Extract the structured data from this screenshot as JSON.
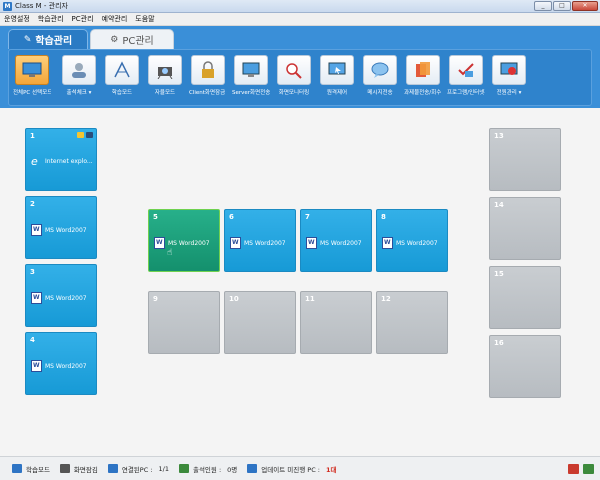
{
  "window": {
    "title": "Class M - 관리자",
    "minimize": "_",
    "maximize": "□",
    "close": "✕",
    "app_icon": "M"
  },
  "menu": [
    "운영설정",
    "학습관리",
    "PC관리",
    "예약관리",
    "도움말"
  ],
  "tabs": [
    {
      "label": "학습관리",
      "icon": "pencil-icon"
    },
    {
      "label": "PC관리",
      "icon": "gear-icon"
    }
  ],
  "toolbar": [
    {
      "label": "전체PC 선택모드",
      "icon": "monitor-icon",
      "selected": true
    },
    {
      "label": "출석체크 ▾",
      "icon": "attendance-icon"
    },
    {
      "label": "학습모드",
      "icon": "drawing-icon"
    },
    {
      "label": "자율모드",
      "icon": "camera-icon"
    },
    {
      "label": "Client화면잠금 ▾",
      "icon": "lock-icon"
    },
    {
      "label": "Server화면전송",
      "icon": "screen-send-icon"
    },
    {
      "label": "화면모니터링",
      "icon": "magnifier-icon"
    },
    {
      "label": "원격제어",
      "icon": "remote-control-icon"
    },
    {
      "label": "메시지전송",
      "icon": "message-icon"
    },
    {
      "label": "과제물전송/회수 ▾",
      "icon": "assignment-icon"
    },
    {
      "label": "프로그램/인터넷관리",
      "icon": "program-control-icon"
    },
    {
      "label": "전원관리 ▾",
      "icon": "power-icon"
    }
  ],
  "seats": [
    {
      "num": "1",
      "app": "Internet explo...",
      "state": "blue",
      "icon": "ie-icon"
    },
    {
      "num": "2",
      "app": "MS Word2007",
      "state": "blue",
      "icon": "word-icon"
    },
    {
      "num": "3",
      "app": "MS Word2007",
      "state": "blue",
      "icon": "word-icon"
    },
    {
      "num": "4",
      "app": "MS Word2007",
      "state": "blue",
      "icon": "word-icon"
    },
    {
      "num": "5",
      "app": "MS Word2007",
      "state": "green",
      "icon": "word-icon"
    },
    {
      "num": "6",
      "app": "MS Word2007",
      "state": "blue",
      "icon": "word-icon"
    },
    {
      "num": "7",
      "app": "MS Word2007",
      "state": "blue",
      "icon": "word-icon"
    },
    {
      "num": "8",
      "app": "MS Word2007",
      "state": "blue",
      "icon": "word-icon"
    },
    {
      "num": "9",
      "app": "",
      "state": "gray"
    },
    {
      "num": "10",
      "app": "",
      "state": "gray"
    },
    {
      "num": "11",
      "app": "",
      "state": "gray"
    },
    {
      "num": "12",
      "app": "",
      "state": "gray"
    },
    {
      "num": "13",
      "app": "",
      "state": "gray"
    },
    {
      "num": "14",
      "app": "",
      "state": "gray"
    },
    {
      "num": "15",
      "app": "",
      "state": "gray"
    },
    {
      "num": "16",
      "app": "",
      "state": "gray"
    }
  ],
  "status": {
    "mode": "학습모드",
    "screen_lock": "화면잠김",
    "connected_label": "연결된PC :",
    "connected_value": "1/1",
    "attendance_label": "출석인원 :",
    "attendance_value": "0명",
    "update_label": "업데이트 미진행 PC :",
    "update_value": "1대"
  },
  "colors": {
    "header": "#3a8fd8",
    "seat_active": "#179ad6",
    "seat_selected": "#14906d",
    "seat_off": "#b7bcc1"
  }
}
